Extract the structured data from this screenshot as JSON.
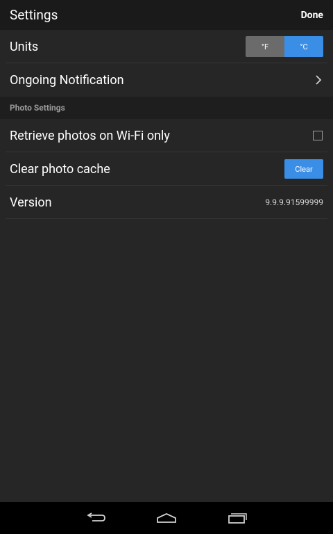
{
  "header": {
    "title": "Settings",
    "done_label": "Done"
  },
  "units": {
    "label": "Units",
    "options": [
      "°F",
      "°C"
    ],
    "selected": "°C"
  },
  "notification": {
    "label": "Ongoing Notification"
  },
  "photo_section": {
    "title": "Photo Settings",
    "wifi_label": "Retrieve photos on Wi-Fi only",
    "wifi_checked": false,
    "cache_label": "Clear photo cache",
    "clear_label": "Clear"
  },
  "version": {
    "label": "Version",
    "value": "9.9.9.91599999"
  },
  "colors": {
    "accent": "#3a8ee6",
    "background": "#262626",
    "header_bg": "#1a1a1a",
    "section_bg": "#1e1e1e",
    "navbar_bg": "#000000"
  },
  "navbar": {
    "icons": [
      "back-icon",
      "home-icon",
      "recent-apps-icon"
    ]
  }
}
